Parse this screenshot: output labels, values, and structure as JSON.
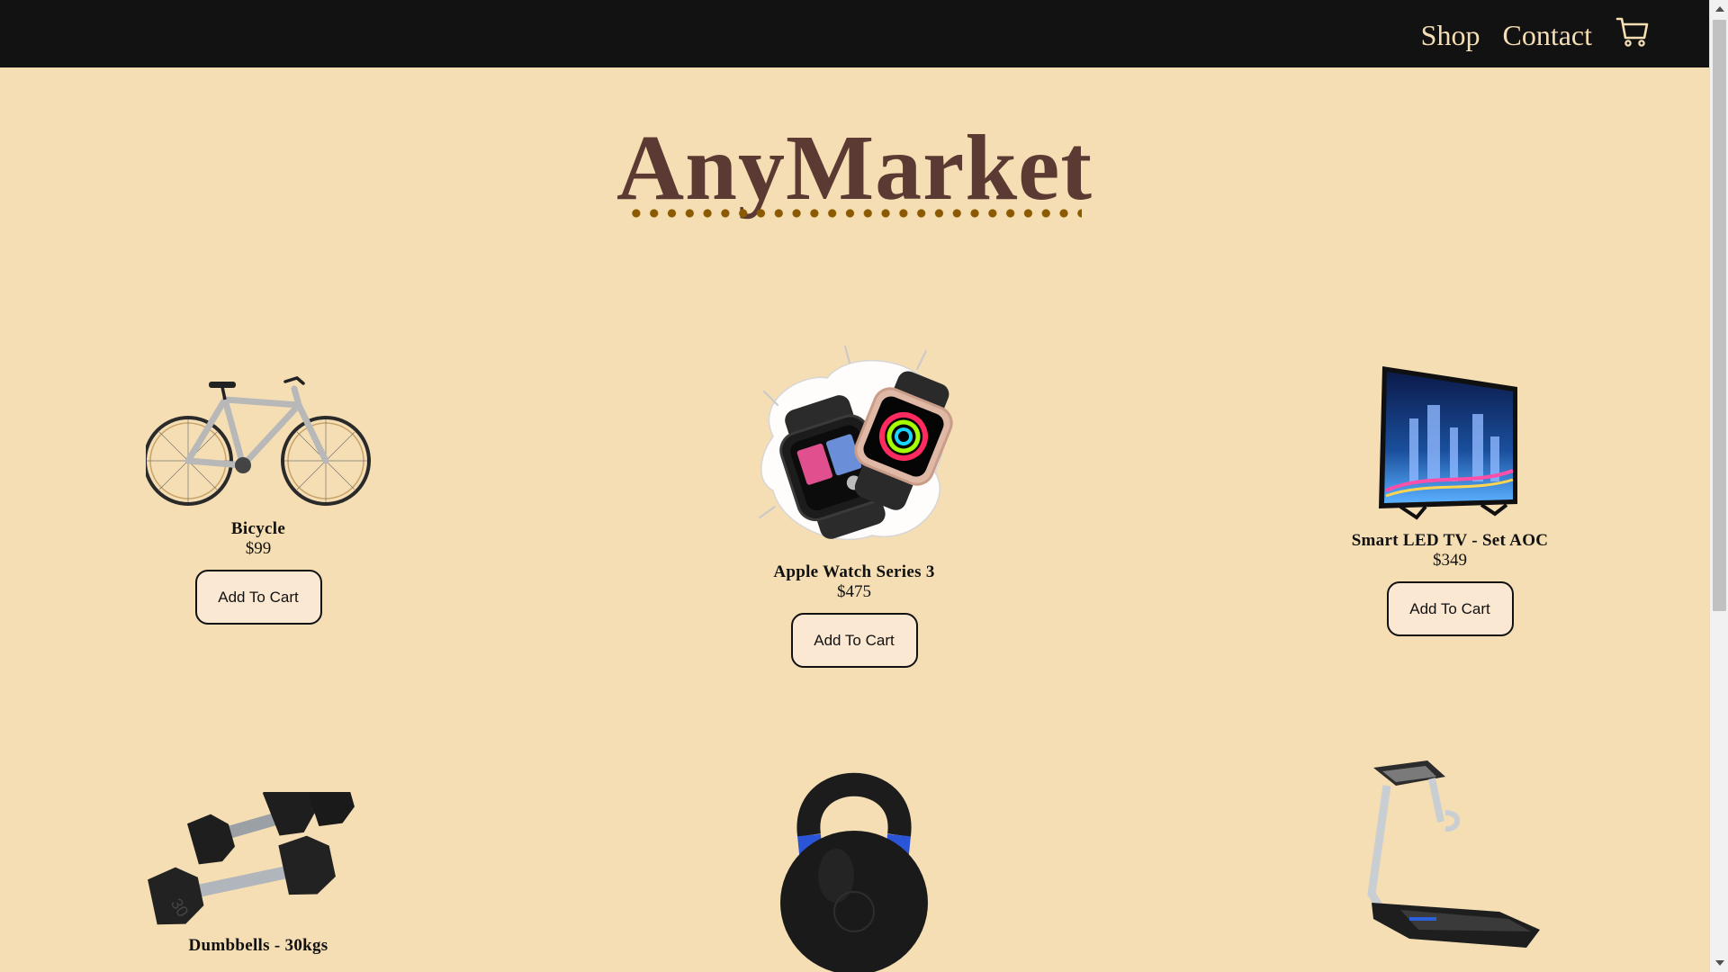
{
  "nav": {
    "links": [
      "Shop",
      "Contact"
    ],
    "cart_icon": "shopping-cart-icon"
  },
  "brand": {
    "title": "AnyMarket"
  },
  "products": [
    {
      "name": "Bicycle",
      "price": "$99",
      "button": "Add To Cart"
    },
    {
      "name": "Apple Watch Series 3",
      "price": "$475",
      "button": "Add To Cart"
    },
    {
      "name": "Smart LED TV - Set AOC",
      "price": "$349",
      "button": "Add To Cart"
    },
    {
      "name": "Dumbbells - 30kgs",
      "price": "",
      "button": ""
    },
    {
      "name": "",
      "price": "",
      "button": ""
    },
    {
      "name": "",
      "price": "",
      "button": ""
    }
  ],
  "colors": {
    "background": "#f5deb3",
    "navbar": "#121212",
    "nav_text": "#f5deb3",
    "brand": "#5a3a32",
    "brand_dots": "#8b5a00",
    "button_bg": "#fbe8d2"
  }
}
